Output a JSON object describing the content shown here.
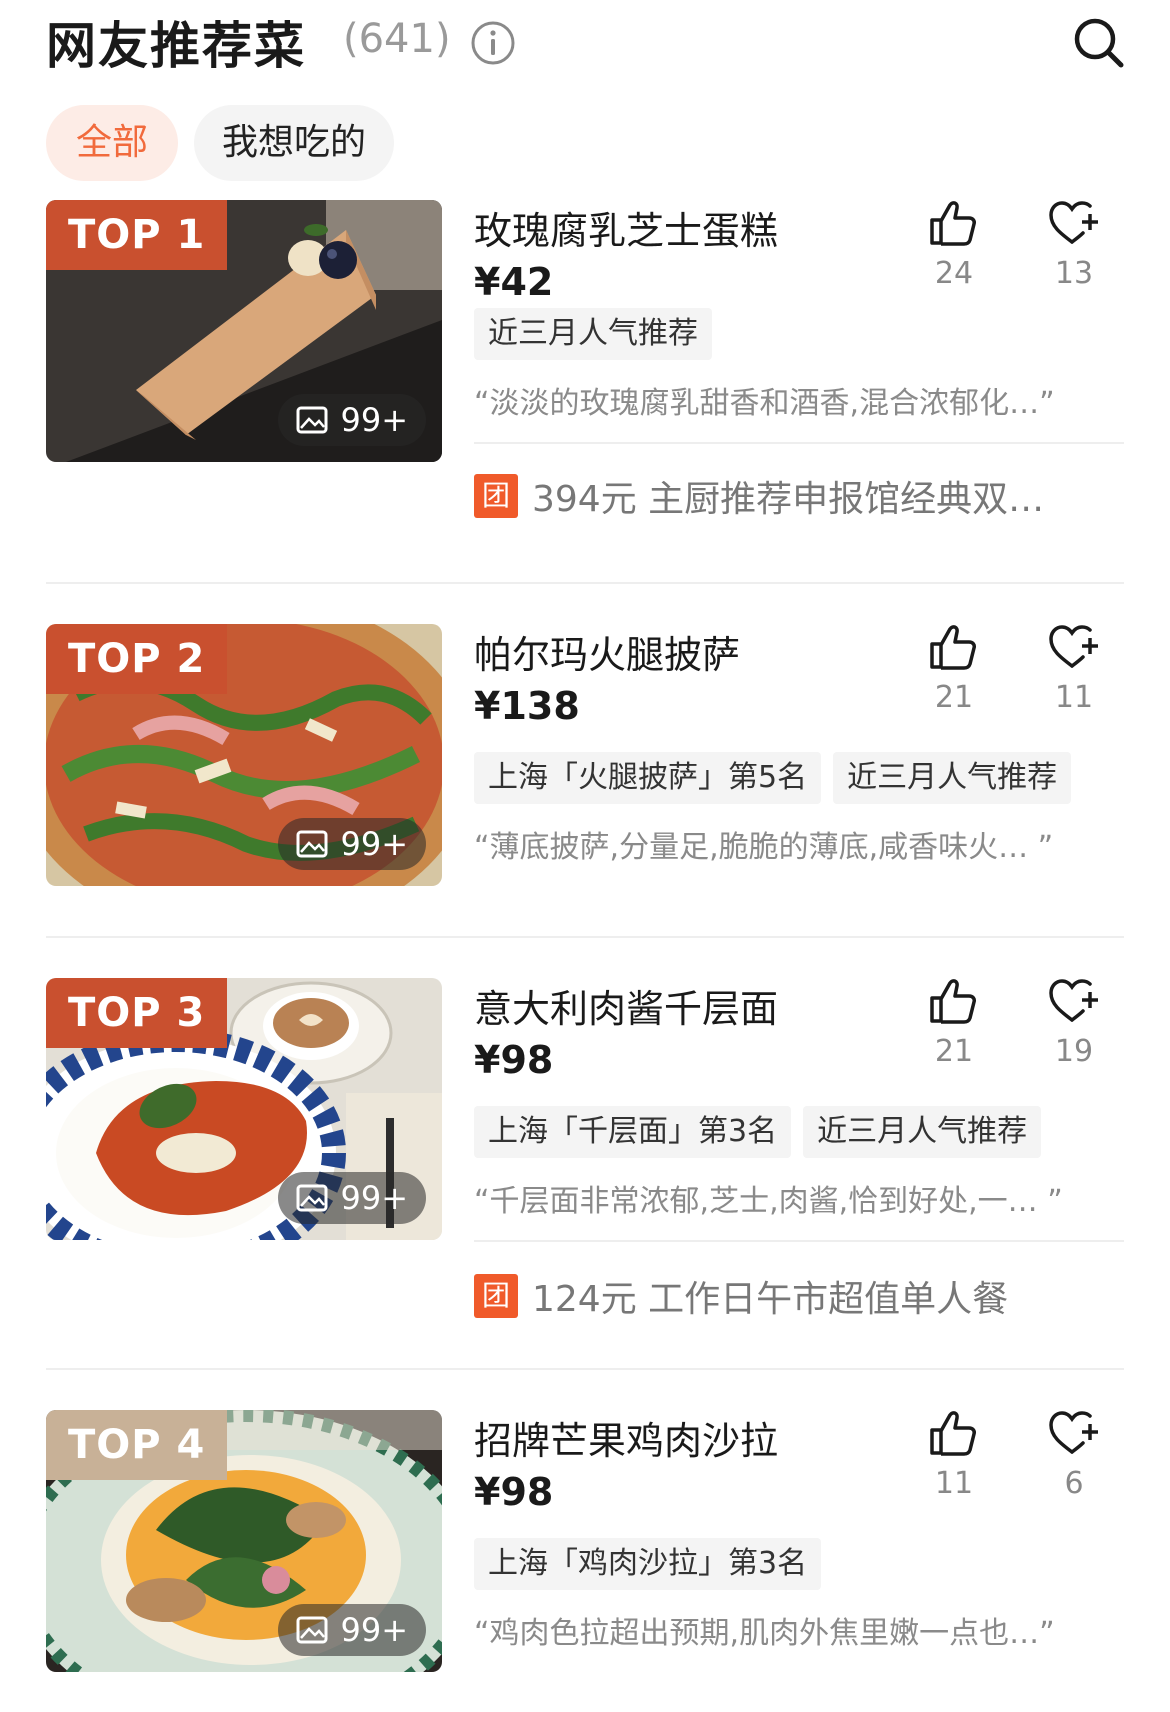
{
  "header": {
    "title": "网友推荐菜",
    "count": "(641)",
    "info_icon": "info-icon",
    "search_icon": "search-icon"
  },
  "filters": [
    {
      "label": "全部",
      "active": true
    },
    {
      "label": "我想吃的",
      "active": false
    }
  ],
  "dishes": [
    {
      "rank": "TOP 1",
      "name": "玫瑰腐乳芝士蛋糕",
      "price": "¥42",
      "likes": "24",
      "favorites": "13",
      "photos": "99+",
      "tags": [
        "近三月人气推荐"
      ],
      "review": "“淡淡的玫瑰腐乳甜香和酒香,混合浓郁化…”",
      "deal": "394元 主厨推荐申报馆经典双…"
    },
    {
      "rank": "TOP 2",
      "name": "帕尔玛火腿披萨",
      "price": "¥138",
      "likes": "21",
      "favorites": "11",
      "photos": "99+",
      "tags": [
        "上海「火腿披萨」第5名",
        "近三月人气推荐"
      ],
      "review": "“薄底披萨,分量足,脆脆的薄底,咸香味火…  ”"
    },
    {
      "rank": "TOP 3",
      "name": "意大利肉酱千层面",
      "price": "¥98",
      "likes": "21",
      "favorites": "19",
      "photos": "99+",
      "tags": [
        "上海「千层面」第3名",
        "近三月人气推荐"
      ],
      "review": "“千层面非常浓郁,芝士,肉酱,恰到好处,一…  ”",
      "deal": "124元 工作日午市超值单人餐"
    },
    {
      "rank": "TOP 4",
      "name": "招牌芒果鸡肉沙拉",
      "price": "¥98",
      "likes": "11",
      "favorites": "6",
      "photos": "99+",
      "tags": [
        "上海「鸡肉沙拉」第3名"
      ],
      "review": "“鸡肉色拉超出预期,肌肉外焦里嫩一点也…”"
    }
  ],
  "deal_badge": "团",
  "colors": {
    "accent": "#f16a3c",
    "rank_badge": "#c9502f",
    "rank_badge_light": "#c8b197",
    "group_badge": "#f05a2a"
  }
}
